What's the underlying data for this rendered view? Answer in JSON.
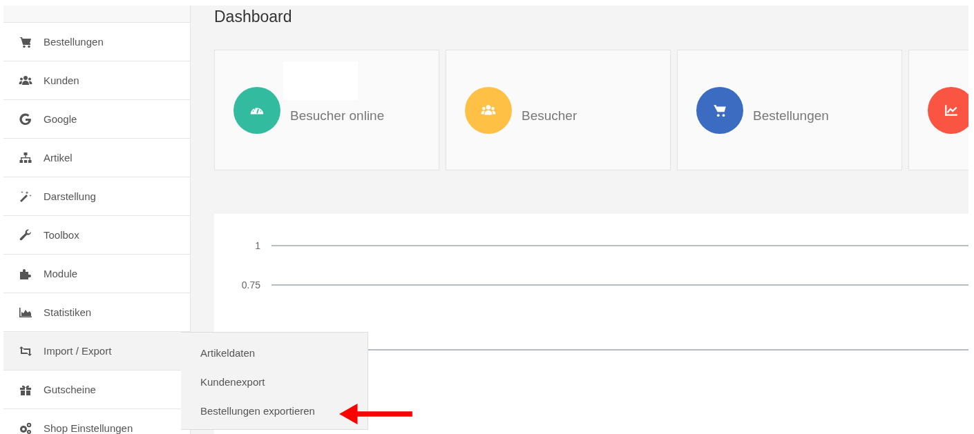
{
  "sidebar": {
    "items": [
      {
        "label": "Bestellungen",
        "kind": "cart",
        "selected": false
      },
      {
        "label": "Kunden",
        "kind": "users",
        "selected": false
      },
      {
        "label": "Google",
        "kind": "google",
        "selected": false
      },
      {
        "label": "Artikel",
        "kind": "sitemap",
        "selected": false
      },
      {
        "label": "Darstellung",
        "kind": "wand",
        "selected": false
      },
      {
        "label": "Toolbox",
        "kind": "wrench",
        "selected": false
      },
      {
        "label": "Module",
        "kind": "puzzle",
        "selected": false
      },
      {
        "label": "Statistiken",
        "kind": "areachart",
        "selected": false
      },
      {
        "label": "Import / Export",
        "kind": "retweet",
        "selected": true,
        "submenu": [
          {
            "label": "Artikeldaten",
            "pointed": false
          },
          {
            "label": "Kundenexport",
            "pointed": false
          },
          {
            "label": "Bestellungen exportieren",
            "pointed": true
          }
        ]
      },
      {
        "label": "Gutscheine",
        "kind": "gift",
        "selected": false
      },
      {
        "label": "Shop Einstellungen",
        "kind": "gears",
        "selected": false
      }
    ]
  },
  "page_title": "Dashboard",
  "cards": [
    {
      "label": "Besucher online",
      "kind": "gauge",
      "color": "#33bb9f",
      "redacted": true
    },
    {
      "label": "Besucher",
      "kind": "users",
      "color": "#ffc145"
    },
    {
      "label": "Bestellungen",
      "kind": "cart",
      "color": "#3b6cc1"
    },
    {
      "kind": "linechart",
      "color": "#fa5443"
    }
  ],
  "chart": {
    "gridlines": [
      {
        "kind": "labeled",
        "label": "1"
      },
      {
        "kind": "labeled",
        "label": "0.75"
      },
      {
        "kind": "plain"
      }
    ]
  }
}
